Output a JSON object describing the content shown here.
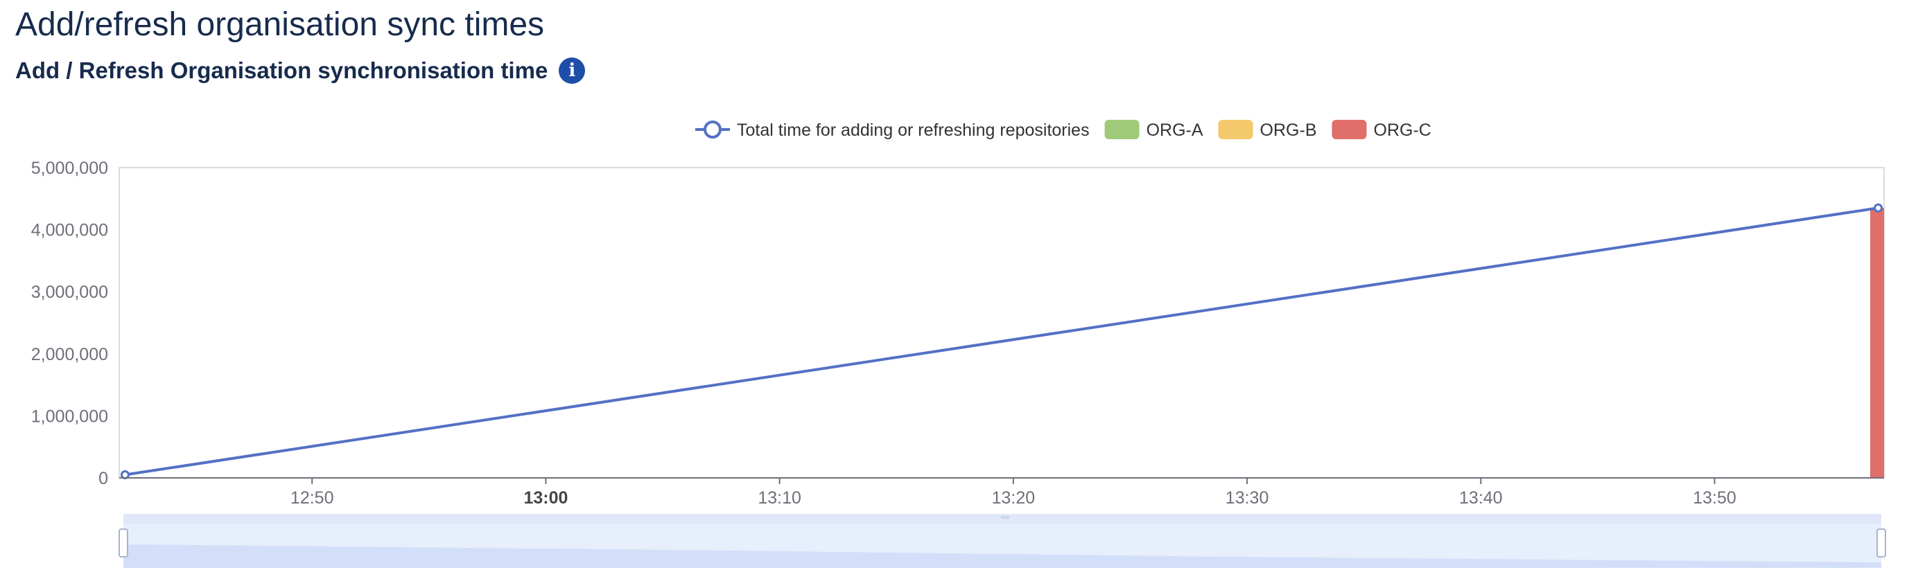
{
  "page": {
    "title": "Add/refresh organisation sync times",
    "section_title": "Add / Refresh Organisation synchronisation time",
    "info_icon": "info-circle-icon"
  },
  "colors": {
    "line": "#5470c6",
    "ORG-A": "#9fca7a",
    "ORG-B": "#f3c96b",
    "ORG-C": "#e06e6a",
    "slider_fill": "#e7eefc",
    "slider_area": "#d3def9"
  },
  "chart_data": {
    "type": "line",
    "title": "",
    "xlabel": "",
    "ylabel": "",
    "legend": [
      {
        "name": "Total time for adding or refreshing repositories",
        "kind": "line",
        "color": "#5470c6"
      },
      {
        "name": "ORG-A",
        "kind": "bar",
        "color": "#9fca7a"
      },
      {
        "name": "ORG-B",
        "kind": "bar",
        "color": "#f3c96b"
      },
      {
        "name": "ORG-C",
        "kind": "bar",
        "color": "#e06e6a"
      }
    ],
    "legend_position": "top-center",
    "x_ticks": [
      "12:50",
      "13:00",
      "13:10",
      "13:20",
      "13:30",
      "13:40",
      "13:50"
    ],
    "x_ticks_bold": [
      "13:00"
    ],
    "xlim": [
      "12:41:45",
      "13:57:15"
    ],
    "y_ticks": [
      "0",
      "1,000,000",
      "2,000,000",
      "3,000,000",
      "4,000,000",
      "5,000,000"
    ],
    "ylim": [
      0,
      5000000
    ],
    "series": [
      {
        "name": "Total time for adding or refreshing repositories",
        "type": "line",
        "x": [
          "12:42",
          "13:57"
        ],
        "values": [
          50000,
          4350000
        ]
      },
      {
        "name": "ORG-C",
        "type": "bar",
        "x": [
          "13:57"
        ],
        "values": [
          4350000
        ]
      }
    ],
    "data_zoom_slider": true,
    "grid": false
  }
}
